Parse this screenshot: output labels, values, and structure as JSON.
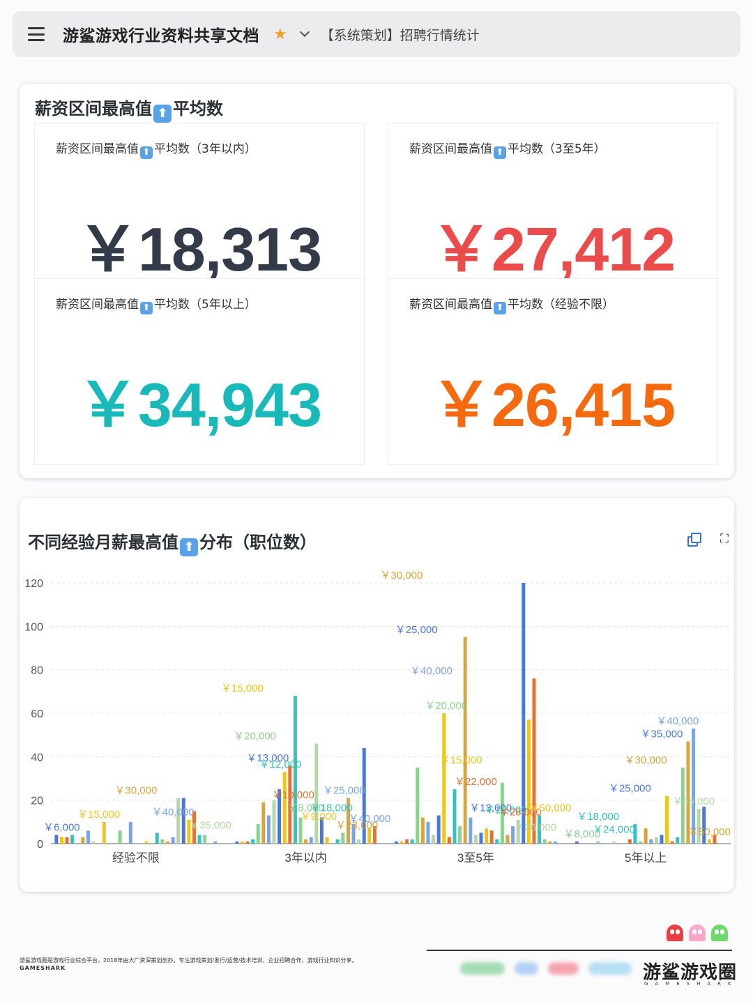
{
  "header": {
    "title": "游鲨游戏行业资料共享文档",
    "breadcrumb": "【系统策划】招聘行情统计"
  },
  "kpi_section": {
    "title_pre": "薪资区间最高值",
    "title_post": "平均数",
    "cards": [
      {
        "label_pre": "薪资区间最高值",
        "label_post": "平均数（3年以内）",
        "value": "￥18,313",
        "color": "#333a48"
      },
      {
        "label_pre": "薪资区间最高值",
        "label_post": "平均数（3至5年）",
        "value": "￥27,412",
        "color": "#ea4b4b"
      },
      {
        "label_pre": "薪资区间最高值",
        "label_post": "平均数（5年以上）",
        "value": "￥34,943",
        "color": "#19b9b9"
      },
      {
        "label_pre": "薪资区间最高值",
        "label_post": "平均数（经验不限）",
        "value": "￥26,415",
        "color": "#f56a0f"
      }
    ]
  },
  "chart_section": {
    "title_pre": "不同经验月薪最高值",
    "title_post": "分布（职位数）"
  },
  "chart_data": {
    "type": "bar",
    "categories": [
      "经验不限",
      "3年以内",
      "3至5年",
      "5年以上"
    ],
    "yticks": [
      0,
      20,
      40,
      60,
      80,
      100,
      120
    ],
    "ylim": [
      0,
      120
    ],
    "bar_colors": [
      "#4a78d8",
      "#f0c419",
      "#e8722c",
      "#34c3c0",
      "#8ad28f",
      "#d7a63c",
      "#7ba4e8",
      "#b4d8a8"
    ],
    "groups": [
      {
        "category": "经验不限",
        "values": [
          4,
          3,
          3,
          4,
          0,
          3,
          6,
          1,
          0,
          10,
          0,
          0,
          6,
          0,
          10,
          0,
          0,
          1,
          0,
          5,
          2,
          1,
          3,
          21,
          21,
          11,
          15,
          4,
          4,
          0,
          1
        ]
      },
      {
        "category": "3年以内",
        "values": [
          1,
          1,
          1,
          2,
          9,
          19,
          13,
          20,
          25,
          33,
          36,
          68,
          12,
          2,
          3,
          46,
          12,
          3,
          0,
          2,
          5,
          21,
          9,
          2,
          44,
          7,
          8
        ]
      },
      {
        "category": "3至5年",
        "values": [
          1,
          1,
          2,
          2,
          35,
          12,
          10,
          4,
          13,
          60,
          3,
          25,
          8,
          95,
          12,
          4,
          5,
          7,
          6,
          2,
          28,
          4,
          8,
          11,
          120,
          57,
          76,
          13,
          2,
          1,
          1
        ]
      },
      {
        "category": "5年以上",
        "values": [
          1,
          0,
          0,
          0,
          1,
          0,
          0,
          1,
          0,
          0,
          2,
          9,
          1,
          7,
          2,
          3,
          4,
          22,
          1,
          3,
          35,
          47,
          53,
          16,
          17,
          2,
          4
        ]
      }
    ],
    "data_labels": [
      {
        "text": "￥6,000",
        "group": 0,
        "value": 4,
        "color": "#4a78d8"
      },
      {
        "text": "￥15,000",
        "group": 0,
        "value": 10,
        "color": "#f0c419"
      },
      {
        "text": "￥30,000",
        "group": 0,
        "value": 21,
        "color": "#d7a63c"
      },
      {
        "text": "￥40,000",
        "group": 0,
        "value": 11,
        "color": "#7ba4e8"
      },
      {
        "text": "￥35,000",
        "group": 0,
        "value": 5,
        "color": "#b4d8a8"
      },
      {
        "text": "￥15,000",
        "group": 1,
        "value": 68,
        "color": "#f0c419"
      },
      {
        "text": "￥20,000",
        "group": 1,
        "value": 46,
        "color": "#8ad28f"
      },
      {
        "text": "￥13,000",
        "group": 1,
        "value": 36,
        "color": "#4a78d8"
      },
      {
        "text": "￥12,000",
        "group": 1,
        "value": 33,
        "color": "#34c3c0"
      },
      {
        "text": "￥10,000",
        "group": 1,
        "value": 19,
        "color": "#e8722c"
      },
      {
        "text": "￥8,000",
        "group": 1,
        "value": 13,
        "color": "#8ad28f"
      },
      {
        "text": "￥9,000",
        "group": 1,
        "value": 9,
        "color": "#f0c419"
      },
      {
        "text": "￥18,000",
        "group": 1,
        "value": 13,
        "color": "#34c3c0"
      },
      {
        "text": "￥25,000",
        "group": 1,
        "value": 21,
        "color": "#7ba4e8"
      },
      {
        "text": "￥23,000",
        "group": 1,
        "value": 5,
        "color": "#d7a63c"
      },
      {
        "text": "￥40,000",
        "group": 1,
        "value": 8,
        "color": "#7ba4e8"
      },
      {
        "text": "￥30,000",
        "group": 2,
        "value": 120,
        "color": "#d7a63c"
      },
      {
        "text": "￥25,000",
        "group": 2,
        "value": 95,
        "color": "#4a78d8"
      },
      {
        "text": "￥40,000",
        "group": 2,
        "value": 76,
        "color": "#7ba4e8"
      },
      {
        "text": "￥20,000",
        "group": 2,
        "value": 60,
        "color": "#8ad28f"
      },
      {
        "text": "￥15,000",
        "group": 2,
        "value": 35,
        "color": "#f0c419"
      },
      {
        "text": "￥22,000",
        "group": 2,
        "value": 25,
        "color": "#e8722c"
      },
      {
        "text": "￥13,000",
        "group": 2,
        "value": 13,
        "color": "#4a78d8"
      },
      {
        "text": "￥12,000",
        "group": 2,
        "value": 12,
        "color": "#34c3c0"
      },
      {
        "text": "￥28,000",
        "group": 2,
        "value": 11,
        "color": "#e8722c"
      },
      {
        "text": "￥26,000",
        "group": 2,
        "value": 4,
        "color": "#b4d8a8"
      },
      {
        "text": "￥50,000",
        "group": 2,
        "value": 13,
        "color": "#f0c419"
      },
      {
        "text": "￥8,000",
        "group": 3,
        "value": 1,
        "color": "#8ad28f"
      },
      {
        "text": "￥18,000",
        "group": 3,
        "value": 9,
        "color": "#34c3c0"
      },
      {
        "text": "￥24,000",
        "group": 3,
        "value": 3,
        "color": "#34c3c0"
      },
      {
        "text": "￥25,000",
        "group": 3,
        "value": 22,
        "color": "#4a78d8"
      },
      {
        "text": "￥30,000",
        "group": 3,
        "value": 35,
        "color": "#d7a63c"
      },
      {
        "text": "￥35,000",
        "group": 3,
        "value": 47,
        "color": "#4a78d8"
      },
      {
        "text": "￥40,000",
        "group": 3,
        "value": 53,
        "color": "#7ba4e8"
      },
      {
        "text": "￥45,000",
        "group": 3,
        "value": 16,
        "color": "#b4d8a8"
      },
      {
        "text": "￥50,000",
        "group": 3,
        "value": 2,
        "color": "#d7a63c"
      }
    ]
  },
  "footer": {
    "description": "游鲨游戏圈是游戏行业综合平台，2018年由大厂资深策划创办。专注游戏策划/发行/运营/技术培训、企业招聘合作、游戏行业知识分享。",
    "brand_small": "GAMESHARK",
    "brand_logo": "游鲨游戏圈",
    "brand_sub": "GAMESHARK",
    "ghost_colors": [
      "#e84040",
      "#f7a8c8",
      "#6ed86e"
    ]
  }
}
